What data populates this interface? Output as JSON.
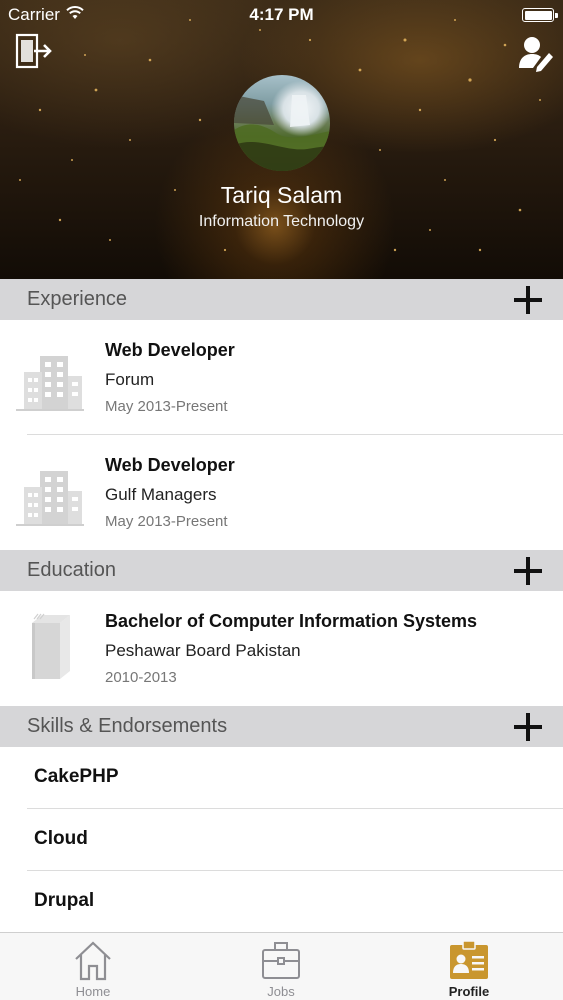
{
  "status_bar": {
    "carrier": "Carrier",
    "time": "4:17 PM"
  },
  "profile": {
    "name": "Tariq Salam",
    "department": "Information Technology"
  },
  "experience": {
    "title": "Experience",
    "items": [
      {
        "title": "Web Developer",
        "company": "Forum",
        "period": "May 2013-Present"
      },
      {
        "title": "Web Developer",
        "company": "Gulf Managers",
        "period": "May 2013-Present"
      }
    ]
  },
  "education": {
    "title": "Education",
    "items": [
      {
        "degree": "Bachelor of Computer Information Systems",
        "institution": "Peshawar Board Pakistan",
        "period": "2010-2013"
      }
    ]
  },
  "skills": {
    "title": "Skills & Endorsements",
    "items": [
      "CakePHP",
      "Cloud",
      "Drupal"
    ]
  },
  "tabbar": {
    "tabs": [
      {
        "label": "Home",
        "icon": "home-icon"
      },
      {
        "label": "Jobs",
        "icon": "briefcase-icon"
      },
      {
        "label": "Profile",
        "icon": "profile-card-icon"
      }
    ],
    "active": "Profile"
  },
  "colors": {
    "section_bg": "#d6d6d8",
    "header_dark": "#2a1d10",
    "accent_gold": "#c9962e"
  }
}
